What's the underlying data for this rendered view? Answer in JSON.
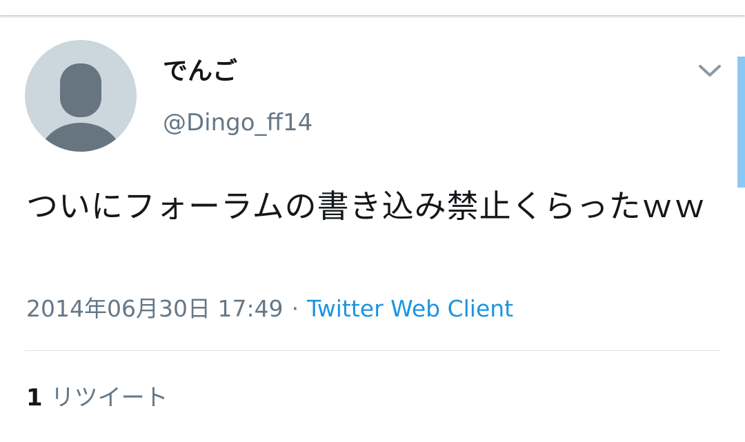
{
  "tweet": {
    "display_name": "でんご",
    "handle": "@Dingo_ff14",
    "text": "ついにフォーラムの書き込み禁止くらったｗｗ",
    "timestamp": "2014年06月30日 17:49",
    "separator": "·",
    "client": "Twitter Web Client",
    "retweet_count": "1",
    "retweet_label": "リツイート"
  },
  "icons": {
    "avatar": "default-avatar-icon",
    "menu": "chevron-down-icon"
  },
  "colors": {
    "accent": "#1b95e0",
    "text": "#14171a",
    "secondary": "#657786",
    "avatar_bg": "#ccd6dd",
    "avatar_fg": "#66757f",
    "scroll": "#8cc9f2"
  }
}
